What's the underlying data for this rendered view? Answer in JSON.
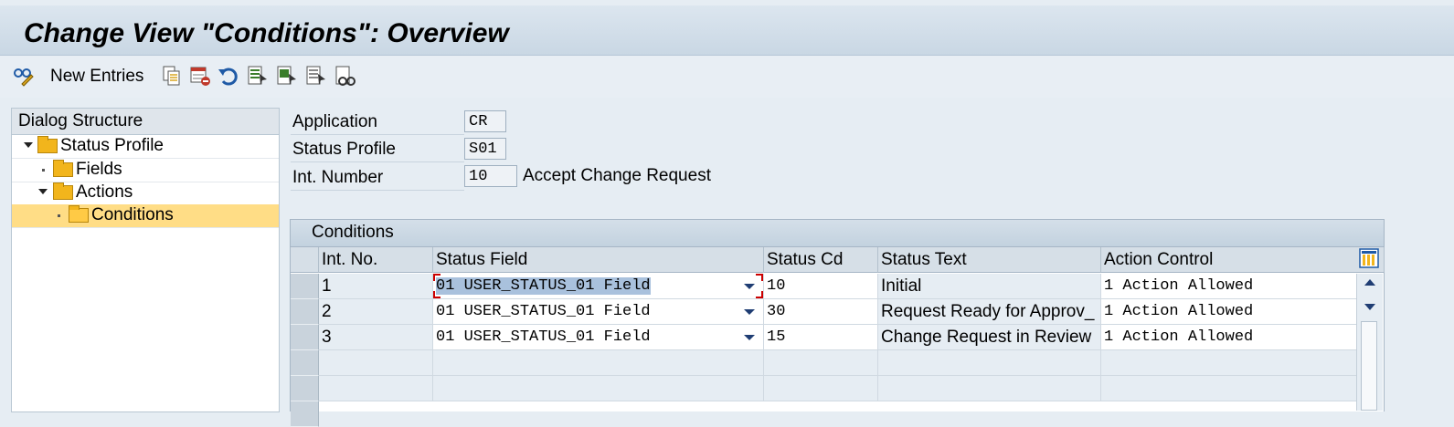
{
  "window": {
    "title": "Change View \"Conditions\": Overview"
  },
  "toolbar": {
    "new_entries_label": "New Entries",
    "icons": [
      "change-display-icon",
      "copy-icon",
      "delete-icon",
      "undo-icon",
      "select-all-icon",
      "select-block-icon",
      "deselect-all-icon",
      "find-icon"
    ]
  },
  "dialog_structure": {
    "header": "Dialog Structure",
    "items": [
      {
        "label": "Status Profile",
        "level": 0,
        "expanded": true
      },
      {
        "label": "Fields",
        "level": 1,
        "expanded": false
      },
      {
        "label": "Actions",
        "level": 1,
        "expanded": true
      },
      {
        "label": "Conditions",
        "level": 2,
        "selected": true
      }
    ]
  },
  "header_fields": {
    "application": {
      "label": "Application",
      "value": "CR"
    },
    "status_profile": {
      "label": "Status Profile",
      "value": "S01"
    },
    "int_number": {
      "label": "Int. Number",
      "value": "10",
      "description": "Accept Change Request"
    }
  },
  "table": {
    "title": "Conditions",
    "columns": [
      "Int. No.",
      "Status Field",
      "Status Cd",
      "Status Text",
      "Action Control"
    ],
    "rows": [
      {
        "int_no": "1",
        "status_field": "01 USER_STATUS_01 Field",
        "status_cd": "10",
        "status_text": "Initial",
        "action_control": "1 Action Allowed"
      },
      {
        "int_no": "2",
        "status_field": "01 USER_STATUS_01 Field",
        "status_cd": "30",
        "status_text": "Request Ready for Approv_",
        "action_control": "1 Action Allowed"
      },
      {
        "int_no": "3",
        "status_field": "01 USER_STATUS_01 Field",
        "status_cd": "15",
        "status_text": "Change Request in Review",
        "action_control": "1 Action Allowed"
      }
    ]
  },
  "colors": {
    "selection": "#ffdd86",
    "background": "#e6edf3",
    "folder": "#f2b51c"
  }
}
